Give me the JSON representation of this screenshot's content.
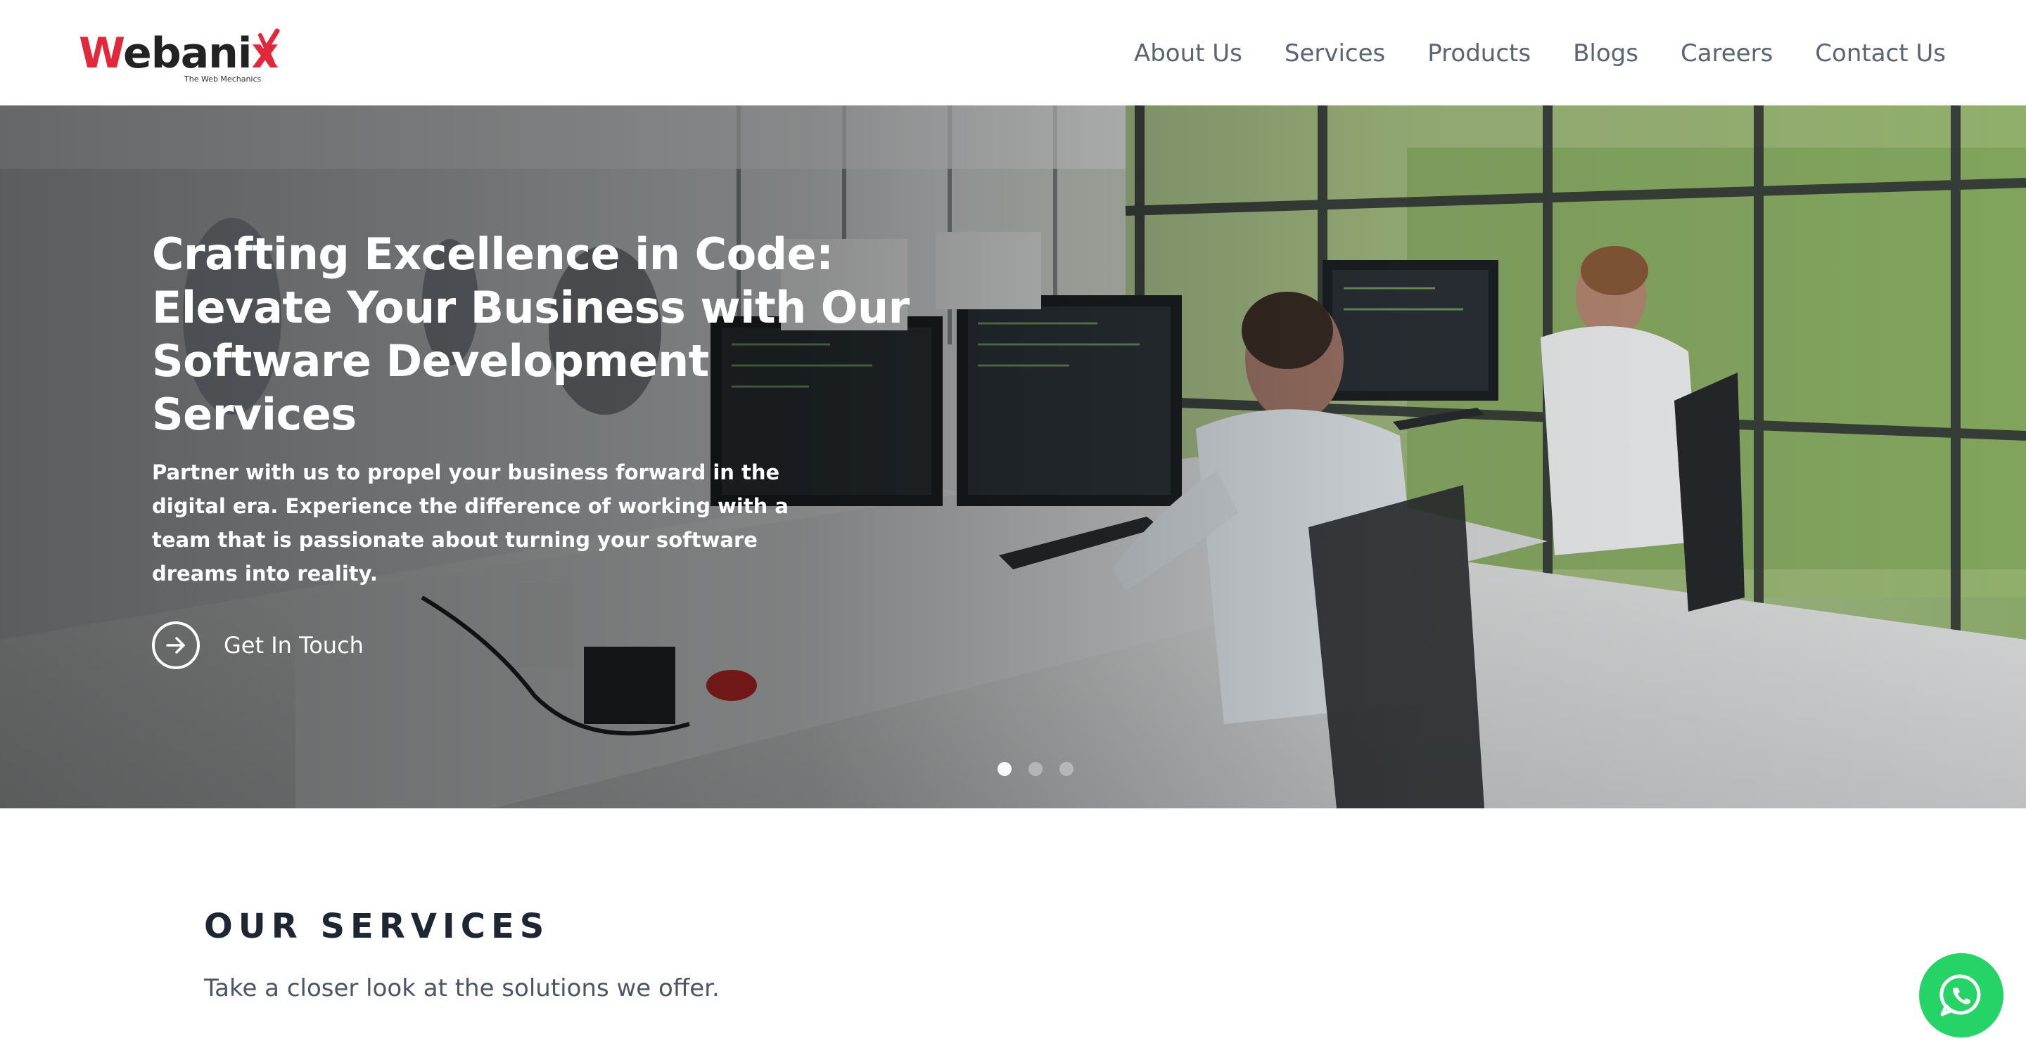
{
  "brand": {
    "name_prefix": "W",
    "name_rest": "ebani",
    "name_suffix": "x",
    "tagline": "The Web Mechanics",
    "accent_color": "#e2283b"
  },
  "nav": {
    "items": [
      {
        "label": "About Us"
      },
      {
        "label": "Services"
      },
      {
        "label": "Products"
      },
      {
        "label": "Blogs"
      },
      {
        "label": "Careers"
      },
      {
        "label": "Contact Us"
      }
    ]
  },
  "hero": {
    "title": "Crafting Excellence in Code:\nElevate Your Business with Our\nSoftware Development Services",
    "subtitle": "Partner with us to propel your business forward in the digital era. Experience the difference of working with a team that is passionate about turning your software dreams into reality.",
    "cta_label": "Get In Touch",
    "cta_icon": "arrow-right-circle-icon",
    "slides": 3,
    "active_slide": 1
  },
  "services": {
    "title": "OUR SERVICES",
    "subtitle": "Take a closer look at the solutions we offer."
  },
  "whatsapp": {
    "icon": "whatsapp-icon",
    "color": "#25d366"
  }
}
